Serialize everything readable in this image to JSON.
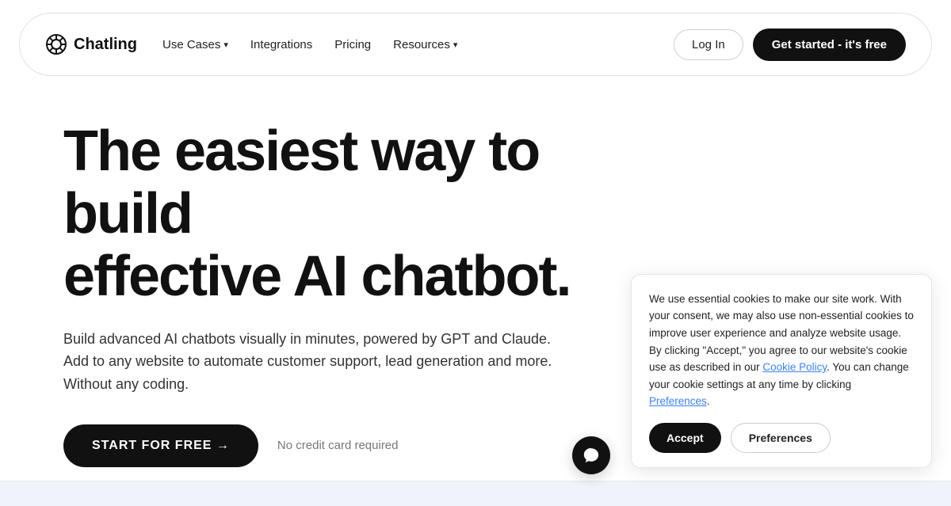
{
  "navbar": {
    "logo_text": "Chatling",
    "nav_links": [
      {
        "label": "Use Cases",
        "has_dropdown": true
      },
      {
        "label": "Integrations",
        "has_dropdown": false
      },
      {
        "label": "Pricing",
        "has_dropdown": false
      },
      {
        "label": "Resources",
        "has_dropdown": true
      }
    ],
    "login_label": "Log In",
    "cta_label": "Get started - it's free"
  },
  "hero": {
    "title_line1": "The easiest way to build",
    "title_line2": "effective AI chatbot.",
    "subtitle": "Build advanced AI chatbots visually in minutes, powered by GPT and Claude. Add to any website to automate customer support, lead generation and more. Without any coding.",
    "cta_button": "START FOR FREE →",
    "no_cc_text": "No credit card required"
  },
  "cookie": {
    "body_text": "We use essential cookies to make our site work. With your consent, we may also use non-essential cookies to improve user experience and analyze website usage. By clicking \"Accept,\" you agree to our website's cookie use as described in our ",
    "link_text": "Cookie Policy",
    "after_link": ". You can change your cookie settings at any time by clicking ",
    "preferences_link": "Preferences",
    "end_punctuation": ".",
    "accept_label": "Accept",
    "preferences_label": "Preferences"
  }
}
